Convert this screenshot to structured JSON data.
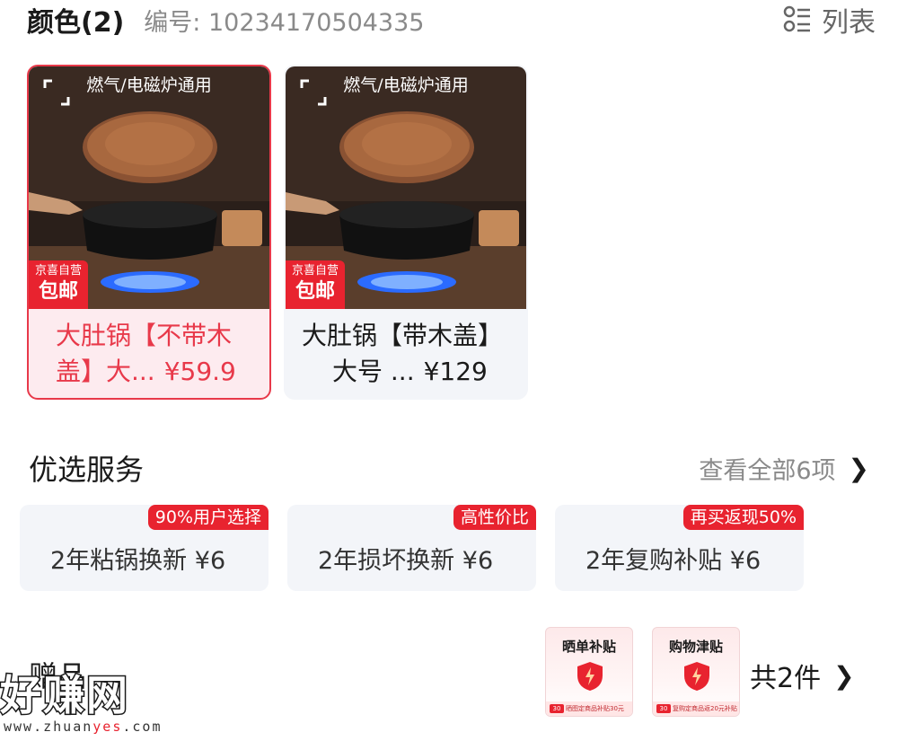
{
  "header": {
    "color_title": "颜色(2)",
    "sku": "编号: 10234170504335",
    "list_label": "列表",
    "list_icon": "list-view-icon"
  },
  "products": [
    {
      "caption": "燃气/电磁炉通用",
      "badge_top": "京喜自营",
      "badge_bottom": "包邮",
      "name_line1": "大肚锅【不带木",
      "name_line2": "盖】大...",
      "price": "¥59.9",
      "selected": true
    },
    {
      "caption": "燃气/电磁炉通用",
      "badge_top": "京喜自营",
      "badge_bottom": "包邮",
      "name_line1": "大肚锅【带木盖】",
      "name_line2": "大号 ...",
      "price": "¥129",
      "selected": false
    }
  ],
  "services_section": {
    "title": "优选服务",
    "view_all": "查看全部6项",
    "items": [
      {
        "tag": "90%用户选择",
        "label": "2年粘锅换新  ¥6"
      },
      {
        "tag": "高性价比",
        "label": "2年损坏换新  ¥6"
      },
      {
        "tag": "再买返现50%",
        "label": "2年复购补贴  ¥6"
      }
    ]
  },
  "gifts_section": {
    "title": "赠品",
    "count": "共2件",
    "items": [
      {
        "title": "晒单补贴",
        "amount": "30",
        "note": "晒图定商品补贴30元"
      },
      {
        "title": "购物津贴",
        "amount": "30",
        "note": "复购定商品返20元补贴"
      }
    ]
  },
  "watermark": {
    "logo": "好赚网",
    "url_prefix": "www.zhuan",
    "url_highlight": "yes",
    "url_suffix": ".com"
  },
  "colors": {
    "accent": "#e8394a",
    "badge_red": "#e8232f",
    "card_bg": "#f3f5f9",
    "selected_bg": "#fdebef"
  }
}
